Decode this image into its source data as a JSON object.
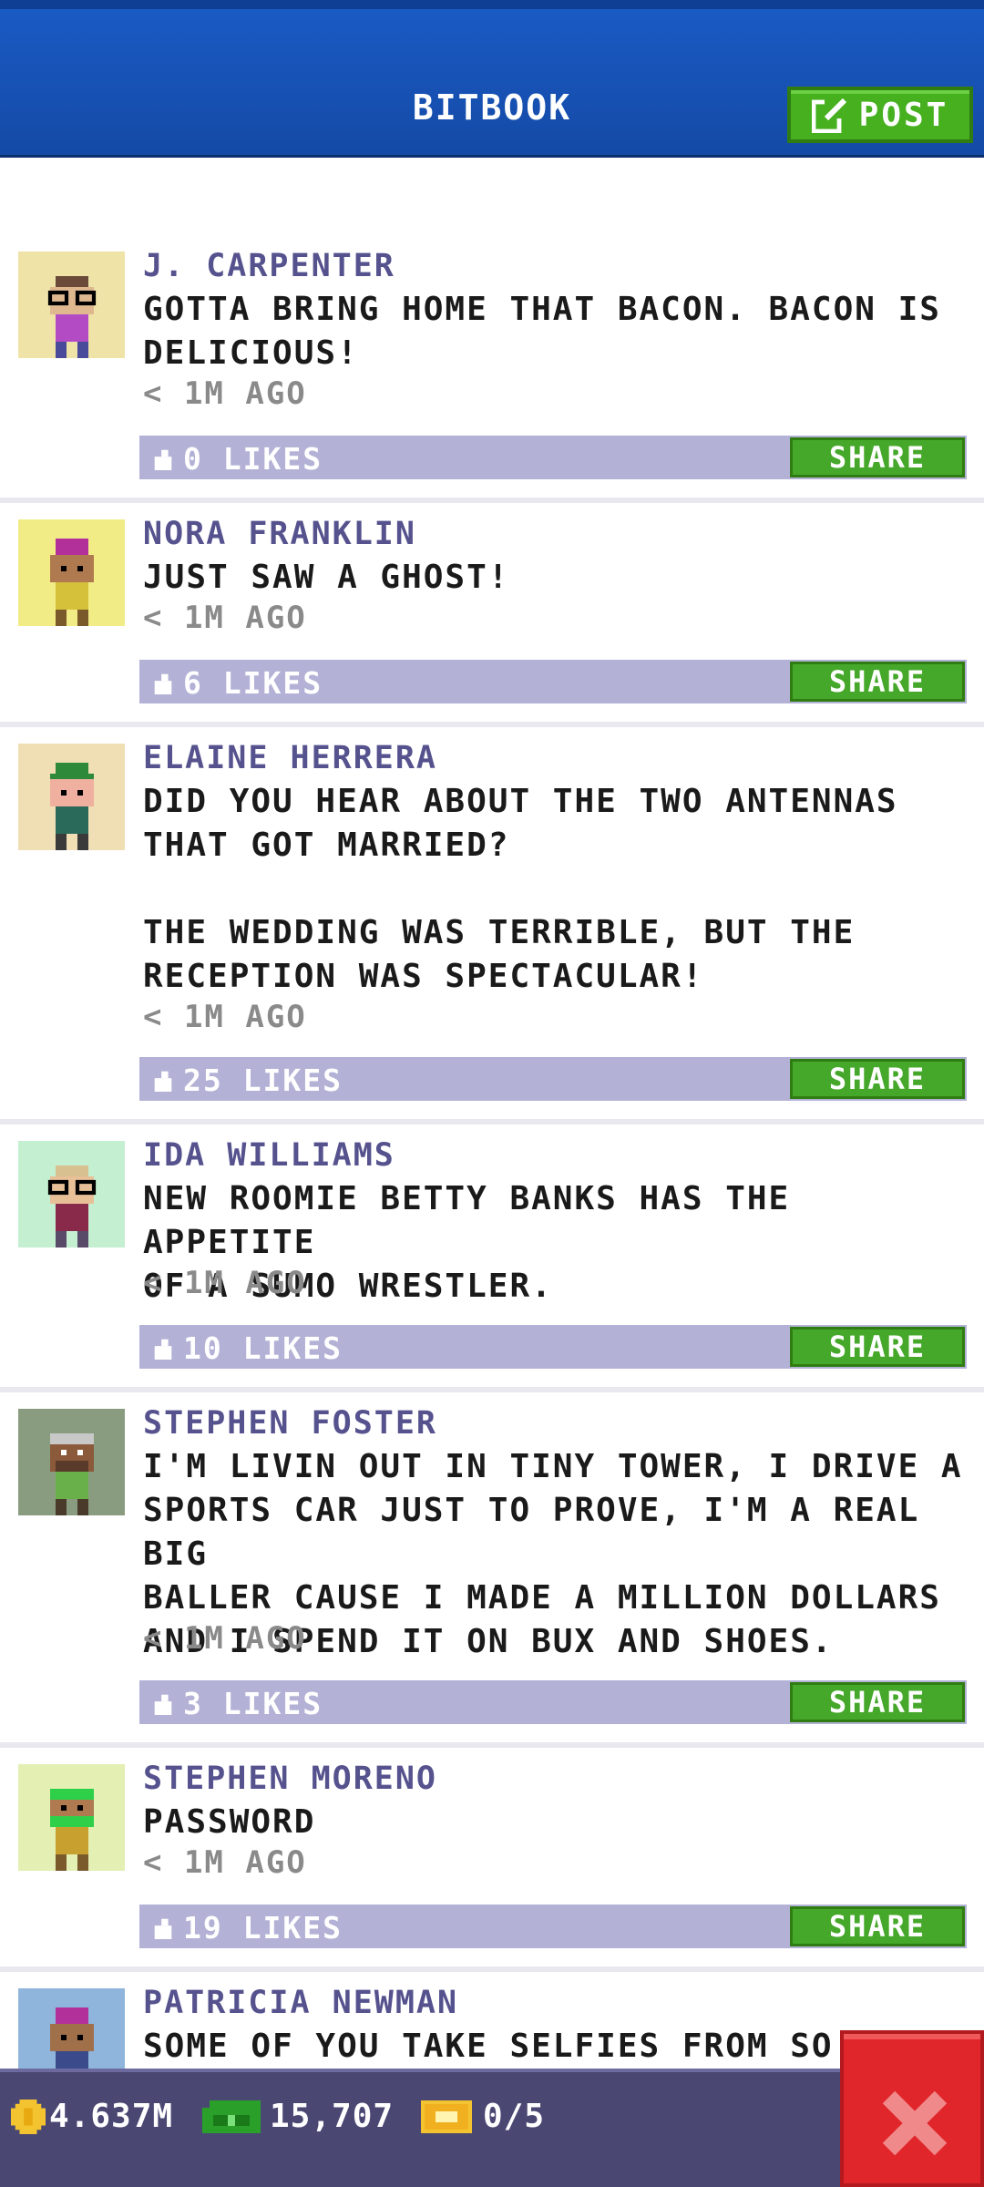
{
  "header": {
    "title": "BITBOOK",
    "post_label": "POST"
  },
  "posts": [
    {
      "name": "J. CARPENTER",
      "message": "GOTTA BRING HOME THAT BACON. BACON IS\nDELICIOUS!",
      "time": "< 1M AGO",
      "likes": "0 LIKES",
      "share": "SHARE",
      "avatar_bg": "#efe3a8"
    },
    {
      "name": "NORA FRANKLIN",
      "message": "JUST SAW A GHOST!",
      "time": "< 1M AGO",
      "likes": "6 LIKES",
      "share": "SHARE",
      "avatar_bg": "#f2ec86"
    },
    {
      "name": "ELAINE HERRERA",
      "message": "DID YOU HEAR ABOUT THE TWO ANTENNAS\nTHAT GOT MARRIED?\n\nTHE WEDDING WAS TERRIBLE, BUT THE\nRECEPTION WAS SPECTACULAR!",
      "time": "< 1M AGO",
      "likes": "25 LIKES",
      "share": "SHARE",
      "avatar_bg": "#f0deb4"
    },
    {
      "name": "IDA WILLIAMS",
      "message": "NEW ROOMIE BETTY BANKS HAS THE APPETITE\nOF A SUMO WRESTLER.",
      "time": "< 1M AGO",
      "likes": "10 LIKES",
      "share": "SHARE",
      "avatar_bg": "#c5efd1"
    },
    {
      "name": "STEPHEN FOSTER",
      "message": "I'M LIVIN OUT IN TINY TOWER, I DRIVE A\nSPORTS CAR JUST TO PROVE, I'M A REAL BIG\nBALLER CAUSE I MADE A MILLION DOLLARS\nAND I SPEND IT ON BUX AND SHOES.",
      "time": "< 1M AGO",
      "likes": "3 LIKES",
      "share": "SHARE",
      "avatar_bg": "#8a9c80"
    },
    {
      "name": "STEPHEN MORENO",
      "message": "PASSWORD",
      "time": "< 1M AGO",
      "likes": "19 LIKES",
      "share": "SHARE",
      "avatar_bg": "#e3efb3"
    },
    {
      "name": "PATRICIA NEWMAN",
      "message": "SOME OF YOU TAKE SELFIES FROM SO C",
      "time": "",
      "likes": "",
      "share": "",
      "avatar_bg": "#8fb5dc"
    }
  ],
  "bottom_bar": {
    "coins": "4.637M",
    "bux": "15,707",
    "tickets": "0/5"
  },
  "colors": {
    "header": "#144aa6",
    "accent_green": "#46b01f",
    "likes_bar": "#b3b2d6",
    "name_text": "#55528e",
    "close_red": "#e0262b",
    "bottom_bar": "#4a4773"
  }
}
